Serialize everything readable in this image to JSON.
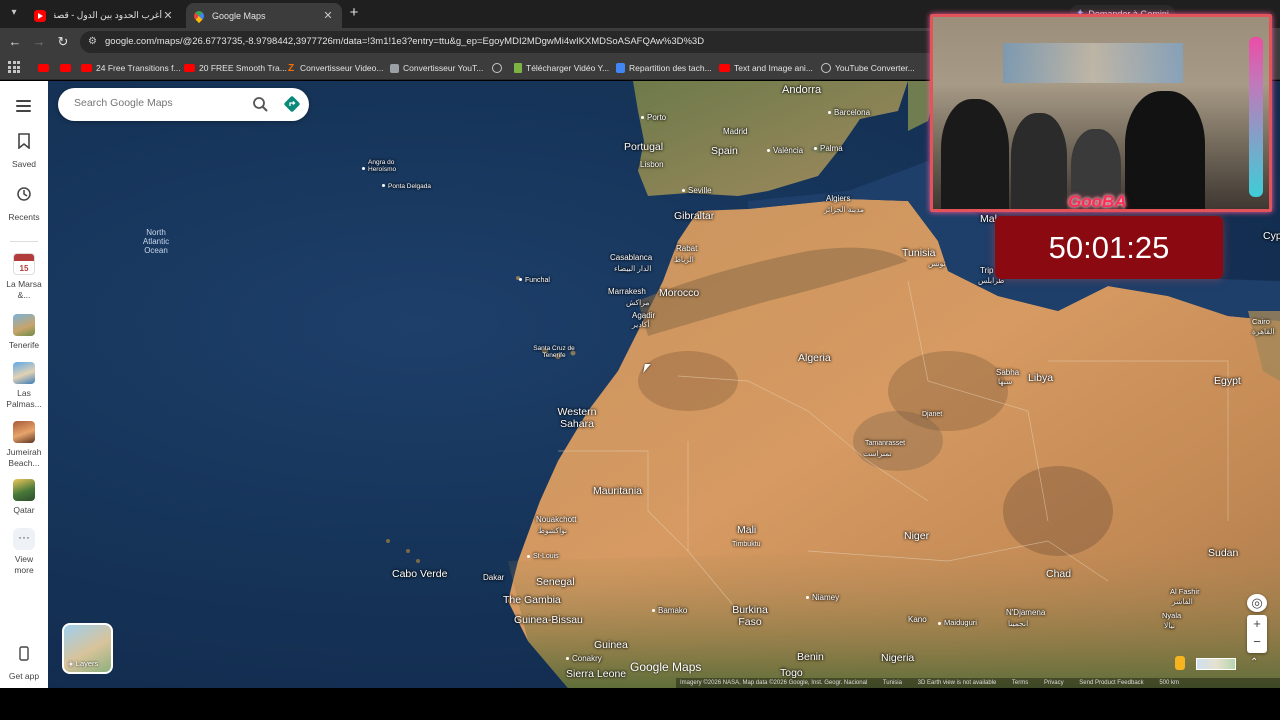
{
  "browser": {
    "tabs": [
      {
        "title": "أغرب الحدود بين الدول - قصة بـ..."
      },
      {
        "title": "Google Maps"
      }
    ],
    "gemini_button": "Demander à Gemini",
    "url": "google.com/maps/@26.6773735,-8.9798442,3977726m/data=!3m1!1e3?entry=ttu&g_ep=EgoyMDI2MDgwMi4wIKXMDSoASAFQAw%3D%3D",
    "bookmarks": [
      {
        "label": "",
        "icon": "youtube-icon"
      },
      {
        "label": "",
        "icon": "youtube-icon"
      },
      {
        "label": "24 Free Transitions f...",
        "icon": "youtube-icon"
      },
      {
        "label": "20 FREE Smooth Tra...",
        "icon": "youtube-icon"
      },
      {
        "label": "Convertisseur Video...",
        "icon": "z-icon"
      },
      {
        "label": "Convertisseur YouT...",
        "icon": "stack-icon"
      },
      {
        "label": "",
        "icon": "globe-icon"
      },
      {
        "label": "Télécharger Vidéo Y...",
        "icon": "download-icon"
      },
      {
        "label": "Repartition des tach...",
        "icon": "doc-icon"
      },
      {
        "label": "Text and Image ani...",
        "icon": "youtube-icon"
      },
      {
        "label": "YouTube Converter...",
        "icon": "globe-icon"
      }
    ]
  },
  "sidebar": {
    "saved": "Saved",
    "recents": "Recents",
    "recent_places": [
      {
        "label": "La Marsa &...",
        "badge": "15"
      },
      {
        "label": "Tenerife"
      },
      {
        "label": "Las Palmas..."
      },
      {
        "label": "Jumeirah Beach..."
      },
      {
        "label": "Qatar"
      }
    ],
    "view_more": "View more",
    "get_app": "Get app"
  },
  "map": {
    "search_placeholder": "Search Google Maps",
    "layers_label": "Layers",
    "logo": "Google Maps",
    "labels": {
      "ocean": "North Atlantic Ocean",
      "andorra": "Andorra",
      "porto": "Porto",
      "madrid": "Madrid",
      "barcelona": "Barcelona",
      "portugal": "Portugal",
      "spain": "Spain",
      "valencia": "València",
      "palma": "Palma",
      "lisbon": "Lisbon",
      "seville": "Seville",
      "gibraltar": "Gibraltar",
      "algiers": "Algiers",
      "algiers_ar": "مدينة الجزائر",
      "tunisia": "Tunisia",
      "tunisia_ar": "تونس",
      "angra": "Angra do Heroísmo",
      "ponta_delgada": "Ponta Delgada",
      "rabat": "Rabat",
      "rabat_ar": "الرباط",
      "casablanca": "Casablanca",
      "casablanca_ar": "الدار البيضاء",
      "funchal": "Funchal",
      "marrakesh": "Marrakesh",
      "marrakesh_ar": "مراكش",
      "morocco": "Morocco",
      "agadir": "Agadir",
      "agadir_ar": "أكادير",
      "santa_cruz": "Santa Cruz de Tenerife",
      "algeria": "Algeria",
      "libya": "Libya",
      "sabha": "Sabha",
      "sabha_ar": "سبها",
      "egypt": "Egypt",
      "western_sahara": "Western Sahara",
      "djanet": "Djanet",
      "tamanrasset": "Tamanrasset",
      "tamanrasset_ar": "تمنراست",
      "mauritania": "Mauritania",
      "nouakchott": "Nouakchott",
      "nouakchott_ar": "نواكشوط",
      "mali": "Mali",
      "timbuktu": "Timbuktu",
      "niger": "Niger",
      "st_louis": "St-Louis",
      "cabo_verde": "Cabo Verde",
      "dakar": "Dakar",
      "senegal": "Senegal",
      "chad": "Chad",
      "sudan": "Sudan",
      "the_gambia": "The Gambia",
      "niamey": "Niamey",
      "bamako": "Bamako",
      "al_fashir": "Al Fashir",
      "al_fashir_ar": "الفاشر",
      "guinea_bissau": "Guinea-Bissau",
      "burkina_faso": "Burkina Faso",
      "ndjamena": "N'Djamena",
      "ndjamena_ar": "انجمينا",
      "nyala": "Nyala",
      "nyala_ar": "نيالا",
      "kano": "Kano",
      "maiduguri": "Maiduguri",
      "guinea": "Guinea",
      "benin": "Benin",
      "nigeria": "Nigeria",
      "conakry": "Conakry",
      "sierra_leone": "Sierra Leone",
      "togo": "Togo",
      "malta_partial": "Mal",
      "tripoli_partial": "Trip",
      "tripoli_ar_partial": "طرابلس",
      "cyprus_partial": "Cyp",
      "cairo_partial": "Cairo",
      "cairo_ar_partial": "القاهرة"
    },
    "attribution": [
      "Imagery ©2026 NASA, Map data ©2026 Google, Inst. Geogr. Nacional",
      "Tunisia",
      "3D Earth view is not available",
      "Terms",
      "Privacy",
      "Send Product Feedback",
      "500 km"
    ]
  },
  "overlay": {
    "streamer_tag": "GooBA",
    "timer": "50:01:25"
  }
}
